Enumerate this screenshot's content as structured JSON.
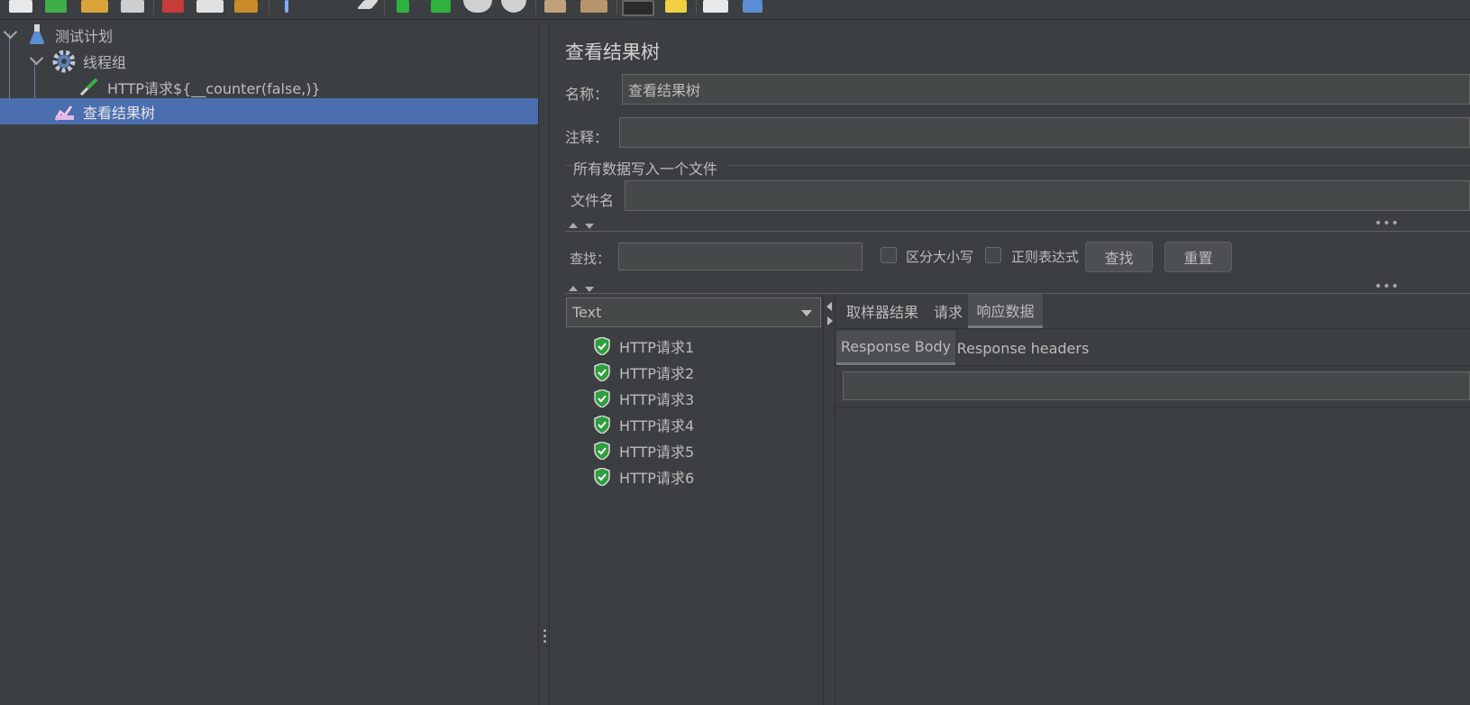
{
  "tree": {
    "items": [
      {
        "label": "测试计划",
        "icon": "flask-icon"
      },
      {
        "label": "线程组",
        "icon": "gear-icon"
      },
      {
        "label": "HTTP请求${__counter(false,)}",
        "icon": "pipette-icon"
      },
      {
        "label": "查看结果树",
        "icon": "chart-icon",
        "selected": true
      }
    ]
  },
  "editor": {
    "title": "查看结果树",
    "name_label": "名称：",
    "name_value": "查看结果树",
    "comment_label": "注释：",
    "comment_value": "",
    "file_group_label": "所有数据写入一个文件",
    "filename_label": "文件名",
    "filename_value": "",
    "search_label": "查找：",
    "search_value": "",
    "case_sensitive_label": "区分大小写",
    "regex_label": "正则表达式",
    "find_button": "查找",
    "reset_button": "重置",
    "renderer_selected": "Text",
    "results": [
      "HTTP请求1",
      "HTTP请求2",
      "HTTP请求3",
      "HTTP请求4",
      "HTTP请求5",
      "HTTP请求6"
    ],
    "tabs": [
      "取样器结果",
      "请求",
      "响应数据"
    ],
    "active_tab": "响应数据",
    "subtabs": [
      "Response Body",
      "Response headers"
    ],
    "active_subtab": "Response Body",
    "response_search_value": ""
  },
  "colors": {
    "background": "#3c3f41",
    "selection": "#4b6eaf",
    "field": "#45494a",
    "success": "#2e9e3e"
  }
}
